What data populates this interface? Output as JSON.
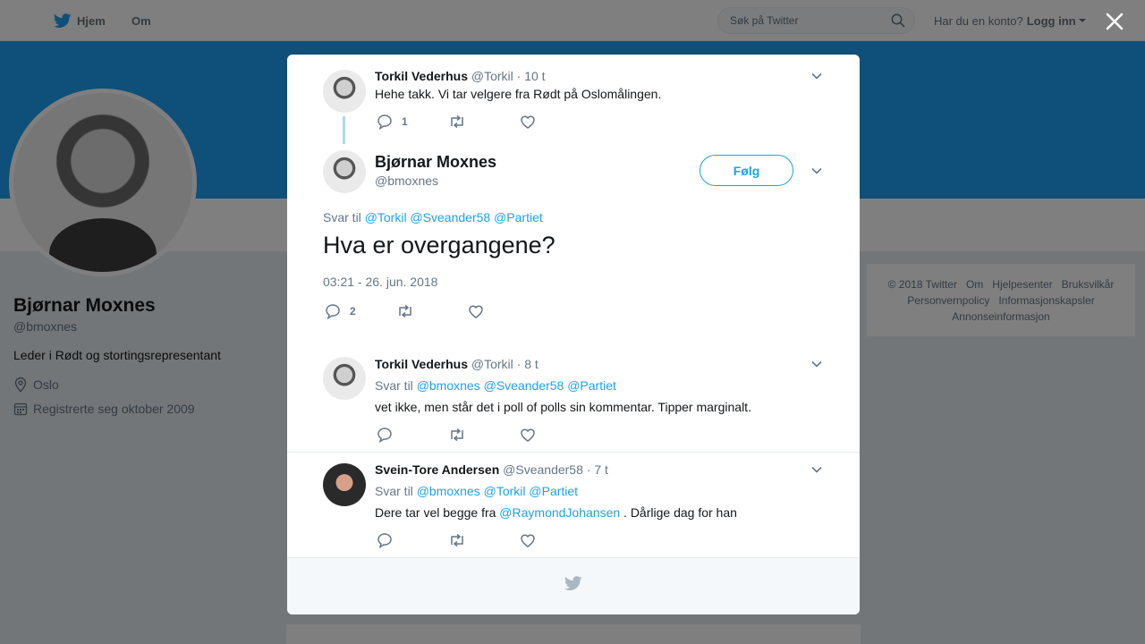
{
  "nav": {
    "home_label": "Hjem",
    "about_label": "Om"
  },
  "search": {
    "placeholder": "Søk på Twitter"
  },
  "account": {
    "prompt": "Har du en konto?",
    "login_label": "Logg inn"
  },
  "profile": {
    "name": "Bjørnar Moxnes",
    "handle": "@bmoxnes",
    "bio": "Leder i Rødt og stortingsrepresentant",
    "location": "Oslo",
    "joined": "Registrerte seg oktober 2009"
  },
  "side_footer": {
    "links": [
      "© 2018 Twitter",
      "Om",
      "Hjelpesenter",
      "Bruksvilkår",
      "Personvernpolicy",
      "Informasjonskapsler",
      "Annonseinformasjon"
    ]
  },
  "parent_tweet": {
    "name": "Torkil Vederhus",
    "handle": "@Torkil",
    "time": "· 10 t",
    "text": "Hehe takk. Vi tar velgere fra Rødt på Oslomålingen.",
    "reply_count": "1"
  },
  "main_tweet": {
    "name": "Bjørnar Moxnes",
    "handle": "@bmoxnes",
    "follow_label": "Følg",
    "reply_prefix": "Svar til",
    "reply_mentions": [
      "@Torkil",
      "@Sveander58",
      "@Partiet"
    ],
    "text": "Hva er overgangene?",
    "timestamp": "03:21 - 26. jun. 2018",
    "reply_count": "2"
  },
  "replies": [
    {
      "name": "Torkil Vederhus",
      "handle": "@Torkil",
      "time": "· 8 t",
      "reply_prefix": "Svar til",
      "mentions": [
        "@bmoxnes",
        "@Sveander58",
        "@Partiet"
      ],
      "text": "vet ikke, men står det i poll of polls sin kommentar. Tipper marginalt."
    },
    {
      "name": "Svein-Tore Andersen",
      "handle": "@Sveander58",
      "time": "· 7 t",
      "reply_prefix": "Svar til",
      "mentions": [
        "@bmoxnes",
        "@Torkil",
        "@Partiet"
      ],
      "text_before": "Dere tar vel begge fra",
      "text_link": "@RaymondJohansen",
      "text_after": ". Dårlige dag for han"
    }
  ],
  "colors": {
    "accent": "#1da1f2",
    "text": "#14171a",
    "muted": "#657786"
  }
}
